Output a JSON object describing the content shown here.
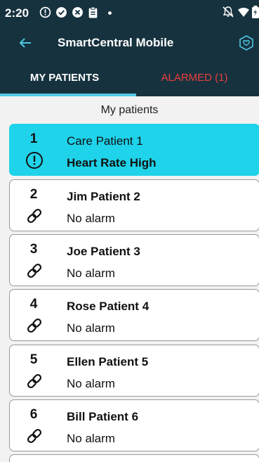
{
  "status_bar": {
    "time": "2:20",
    "notifications": [
      "alert-circle-icon",
      "check-circle-icon",
      "x-circle-icon",
      "clipboard-icon",
      "dot-icon"
    ],
    "system_icons": [
      "bell-off-icon",
      "wifi-icon",
      "battery-icon"
    ]
  },
  "app_bar": {
    "title": "SmartCentral Mobile",
    "back_icon": "arrow-left-icon",
    "action_icon": "hand-heart-icon"
  },
  "tabs": [
    {
      "label": "MY PATIENTS",
      "selected": true
    },
    {
      "label": "ALARMED (1)",
      "selected": false,
      "color": "#ea3f3f"
    }
  ],
  "list_header": "My patients",
  "patients": [
    {
      "number": "1",
      "name": "Care Patient 1",
      "alarm": "Heart Rate High",
      "alarmed": true,
      "icon": "alert-circle-icon"
    },
    {
      "number": "2",
      "name": "Jim Patient 2",
      "alarm": "No alarm",
      "alarmed": false,
      "icon": "link-icon"
    },
    {
      "number": "3",
      "name": "Joe Patient 3",
      "alarm": "No alarm",
      "alarmed": false,
      "icon": "link-icon"
    },
    {
      "number": "4",
      "name": "Rose Patient 4",
      "alarm": "No alarm",
      "alarmed": false,
      "icon": "link-icon"
    },
    {
      "number": "5",
      "name": "Ellen Patient 5",
      "alarm": "No alarm",
      "alarmed": false,
      "icon": "link-icon"
    },
    {
      "number": "6",
      "name": "Bill Patient 6",
      "alarm": "No alarm",
      "alarmed": false,
      "icon": "link-icon"
    }
  ],
  "colors": {
    "header_bg": "#16323e",
    "alarm_card_bg": "#1ed3ea",
    "tab_indicator": "#53c7e6",
    "alarm_tab_text": "#ea3f3f"
  }
}
